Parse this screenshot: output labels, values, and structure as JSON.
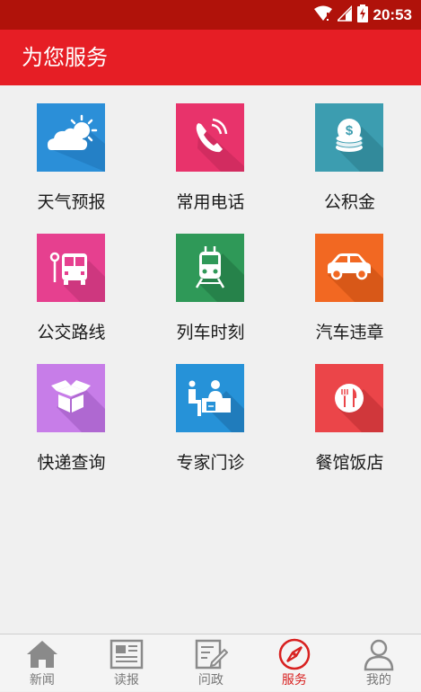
{
  "status_bar": {
    "time": "20:53",
    "icons": [
      "wifi-icon",
      "signal-icon",
      "battery-charging-icon"
    ]
  },
  "header": {
    "title": "为您服务"
  },
  "services": [
    {
      "label": "天气预报",
      "icon": "weather-cloud-sun-icon",
      "color": "#2b8fd8"
    },
    {
      "label": "常用电话",
      "icon": "phone-icon",
      "color": "#e8336b"
    },
    {
      "label": "公积金",
      "icon": "coins-icon",
      "color": "#3c9db0"
    },
    {
      "label": "公交路线",
      "icon": "bus-stop-icon",
      "color": "#e6408f"
    },
    {
      "label": "列车时刻",
      "icon": "train-icon",
      "color": "#2f9958"
    },
    {
      "label": "汽车违章",
      "icon": "car-icon",
      "color": "#f26822"
    },
    {
      "label": "快递查询",
      "icon": "package-icon",
      "color": "#c77de8"
    },
    {
      "label": "专家门诊",
      "icon": "doctor-consult-icon",
      "color": "#2692d8"
    },
    {
      "label": "餐馆饭店",
      "icon": "restaurant-icon",
      "color": "#eb4549"
    }
  ],
  "tabs": [
    {
      "label": "新闻",
      "icon": "home-icon",
      "active": false
    },
    {
      "label": "读报",
      "icon": "newspaper-icon",
      "active": false
    },
    {
      "label": "问政",
      "icon": "edit-form-icon",
      "active": false
    },
    {
      "label": "服务",
      "icon": "compass-icon",
      "active": true
    },
    {
      "label": "我的",
      "icon": "user-icon",
      "active": false
    }
  ],
  "colors": {
    "status_bar": "#b0120a",
    "header": "#e61e25",
    "tab_active": "#d8201f",
    "tab_inactive": "#777777"
  }
}
